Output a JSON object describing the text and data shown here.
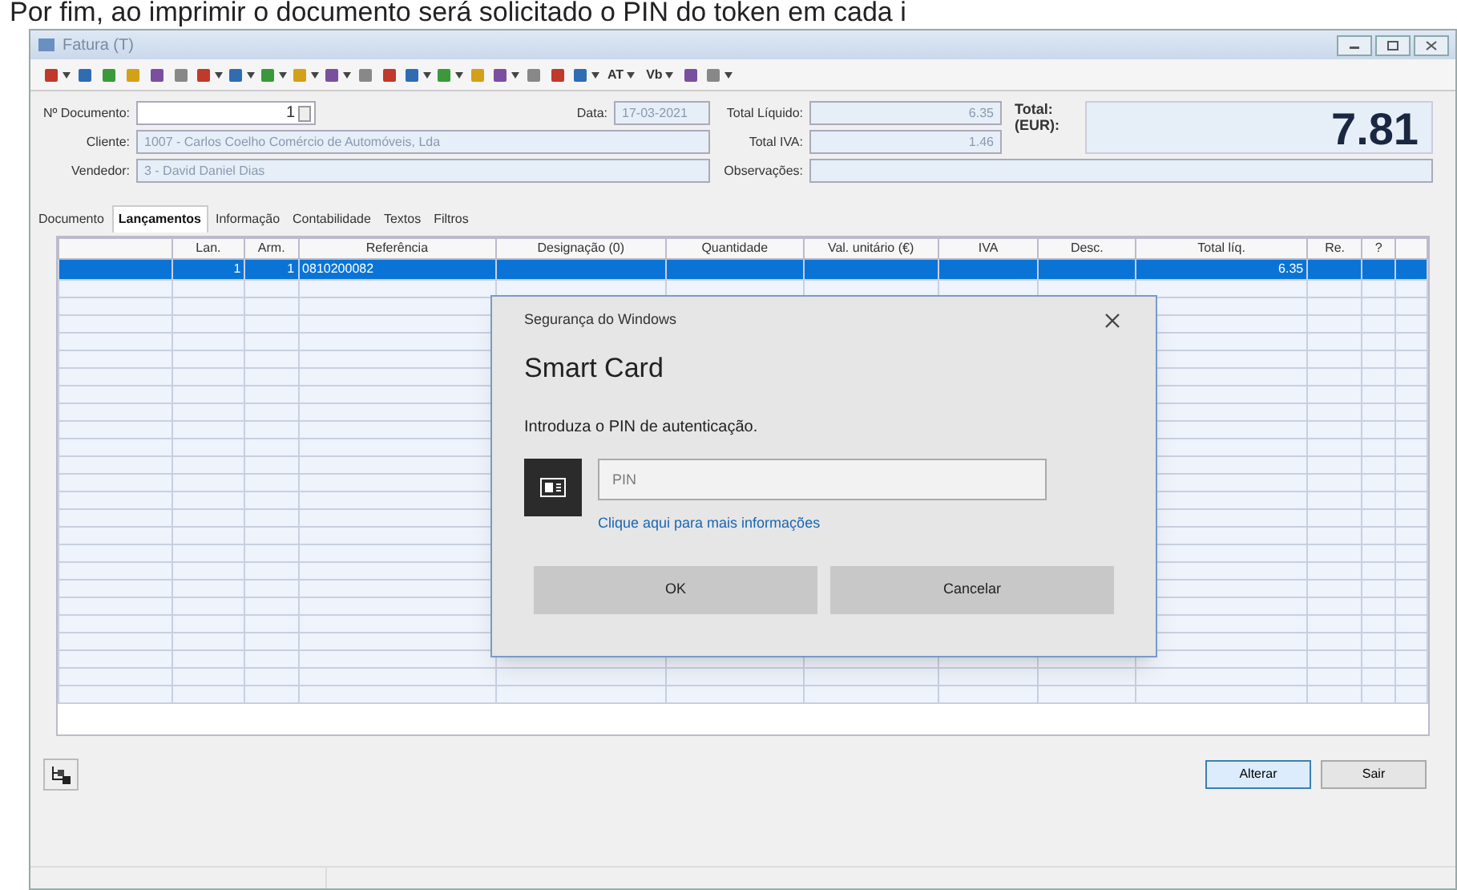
{
  "caption": "Por fim, ao imprimir o documento será solicitado o PIN do token em cada i",
  "window": {
    "title": "Fatura (T)"
  },
  "toolbar": [
    {
      "kind": "icon",
      "caret": true
    },
    {
      "kind": "icon",
      "caret": false
    },
    {
      "kind": "icon",
      "caret": false
    },
    {
      "kind": "icon",
      "caret": false
    },
    {
      "kind": "icon",
      "caret": false
    },
    {
      "kind": "icon",
      "caret": false
    },
    {
      "kind": "icon",
      "caret": true
    },
    {
      "kind": "icon",
      "caret": true
    },
    {
      "kind": "icon",
      "caret": true
    },
    {
      "kind": "icon",
      "caret": true
    },
    {
      "kind": "icon",
      "caret": true
    },
    {
      "kind": "icon",
      "caret": false
    },
    {
      "kind": "icon",
      "caret": false
    },
    {
      "kind": "icon",
      "caret": true
    },
    {
      "kind": "icon",
      "caret": true
    },
    {
      "kind": "icon",
      "caret": false
    },
    {
      "kind": "icon",
      "caret": true
    },
    {
      "kind": "icon",
      "caret": false
    },
    {
      "kind": "icon",
      "caret": false
    },
    {
      "kind": "icon",
      "caret": true
    },
    {
      "kind": "text",
      "label": "AT",
      "caret": true
    },
    {
      "kind": "text",
      "label": "Vb",
      "caret": true
    },
    {
      "kind": "icon",
      "caret": false
    },
    {
      "kind": "icon",
      "caret": true
    }
  ],
  "form": {
    "doc_label": "Nº Documento:",
    "doc_value": "1",
    "date_label": "Data:",
    "date_value": "17-03-2021",
    "client_label": "Cliente:",
    "client_value": "1007 - Carlos Coelho Comércio de Automóveis, Lda",
    "seller_label": "Vendedor:",
    "seller_value": "3 - David Daniel Dias",
    "net_label": "Total Líquido:",
    "net_value": "6.35",
    "vat_label": "Total IVA:",
    "vat_value": "1.46",
    "notes_label": "Observações:",
    "total_label": "Total:",
    "total_currency": "(EUR):",
    "total_value": "7.81"
  },
  "tabs": [
    {
      "label": "Documento",
      "selected": false
    },
    {
      "label": "Lançamentos",
      "selected": true
    },
    {
      "label": "Informação",
      "selected": false
    },
    {
      "label": "Contabilidade",
      "selected": false
    },
    {
      "label": "Textos",
      "selected": false
    },
    {
      "label": "Filtros",
      "selected": false
    }
  ],
  "table": {
    "columns": [
      "",
      "Lan.",
      "Arm.",
      "Referência",
      "Designação (0)",
      "Quantidade",
      "Val. unitário (€)",
      "IVA",
      "Desc.",
      "Total líq.",
      "Re.",
      "?",
      ""
    ],
    "rows": [
      {
        "selected": true,
        "cells": [
          "",
          "1",
          "1",
          "0810200082",
          "",
          "",
          "",
          "",
          "",
          "6.35",
          "",
          "",
          ""
        ]
      }
    ]
  },
  "dialog": {
    "source": "Segurança do Windows",
    "title": "Smart Card",
    "message": "Introduza o PIN de autenticação.",
    "pin_placeholder": "PIN",
    "link": "Clique aqui para mais informações",
    "ok": "OK",
    "cancel": "Cancelar"
  },
  "buttons": [
    {
      "label": "Alterar",
      "selected": true
    },
    {
      "label": "Sair",
      "selected": false
    }
  ]
}
